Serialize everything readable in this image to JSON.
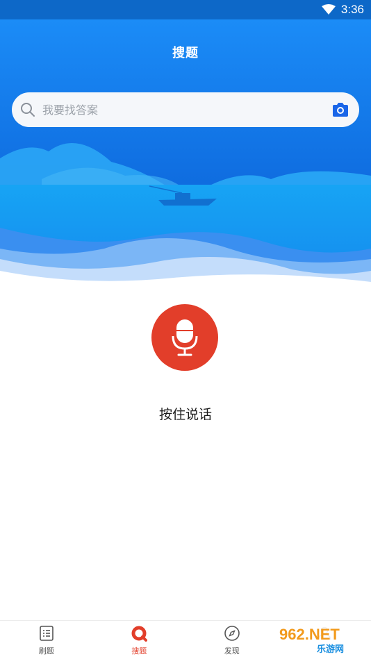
{
  "status_bar": {
    "time": "3:36"
  },
  "header": {
    "title": "搜题"
  },
  "search": {
    "placeholder": "我要找答案"
  },
  "voice": {
    "hold_label": "按住说话"
  },
  "tabs": [
    {
      "label": "刷题",
      "icon": "list-icon",
      "active": false
    },
    {
      "label": "搜题",
      "icon": "search-o-icon",
      "active": true
    },
    {
      "label": "发现",
      "icon": "compass-icon",
      "active": false
    },
    {
      "label": "",
      "icon": "user-icon",
      "active": false
    }
  ],
  "watermark": {
    "text": "962.NET",
    "subtext": "乐游网"
  },
  "colors": {
    "accent": "#e23e2a",
    "brand_blue": "#1a7cf0",
    "search_bg": "#f5f7fa"
  }
}
